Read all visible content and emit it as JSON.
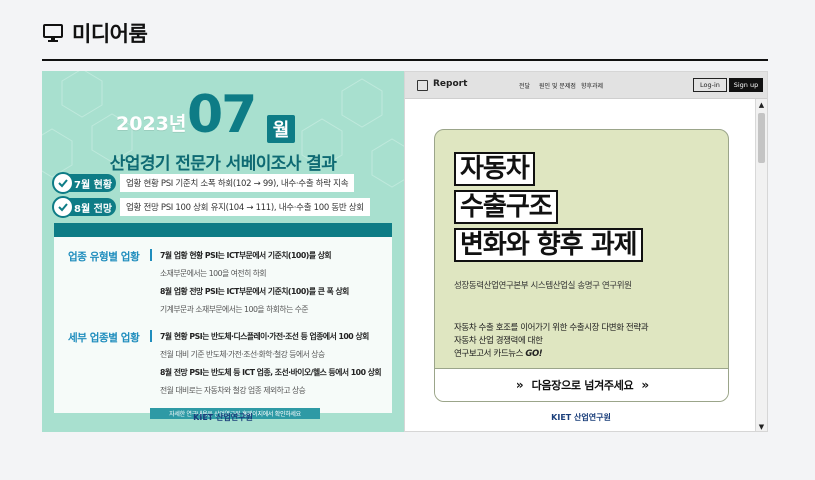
{
  "header": {
    "title": "미디어룸",
    "icon": "monitor-icon"
  },
  "card1": {
    "year": "2023년",
    "month_number": "07",
    "month_suffix": "월",
    "title": "산업경기 전문가 서베이조사 결과",
    "stats": [
      {
        "badge": "7월 현황",
        "text": "업황 현황 PSI 기준치 소폭 하회(102 → 99), 내수·수출 하락 지속"
      },
      {
        "badge": "8월 전망",
        "text": "업황 전망 PSI 100 상회 유지(104 → 111), 내수·수출 100 동반 상회"
      }
    ],
    "section1": {
      "label": "업종 유형별 업황",
      "lines": [
        "7월 업황 현황 PSI는 ICT부문에서 기준치(100)를 상회",
        "소재부문에서는 100을 여전히 하회",
        "8월 업황 전망 PSI는 ICT부문에서 기준치(100)를 큰 폭 상회",
        "기계부문과 소재부문에서는 100을 하회하는 수준"
      ]
    },
    "section2": {
      "label": "세부 업종별 업황",
      "lines": [
        "7월 현황 PSI는 반도체·디스플레이·가전·조선 등 업종에서 100 상회",
        "전월 대비 기준 반도체·가전·조선·화학·철강 등에서 상승",
        "8월 전망 PSI는 반도체 등 ICT 업종, 조선·바이오/헬스 등에서 100 상회",
        "전월 대비로는 자동차와 철강 업종 제외하고 상승"
      ]
    },
    "note": "자세한 연구내용은 산업연구원 홈페이지에서 확인하세요",
    "logo": "KIET 산업연구원"
  },
  "card2": {
    "topbar": {
      "title": "Report",
      "nav": [
        "전달",
        "원인 및 문제점",
        "향후과제"
      ],
      "login": "Log-in",
      "signup": "Sign up"
    },
    "headline": [
      "자동차",
      "수출구조",
      "변화와 향후 과제"
    ],
    "author": "성장동력산업연구본부 시스템산업실 송명구 연구위원",
    "desc_lines": [
      "자동차 수출 호조를 이어가기 위한 수출시장 다변화 전략과",
      "자동차 산업 경쟁력에 대한"
    ],
    "desc_last": "연구보고서 카드뉴스",
    "desc_go": "GO!",
    "next_label": "다음장으로 넘겨주세요",
    "logo": "KIET 산업연구원"
  },
  "colors": {
    "teal": "#0e7c86",
    "mint": "#a8e0cf",
    "olive": "#dfe6c1",
    "blue": "#1f8dbd"
  }
}
